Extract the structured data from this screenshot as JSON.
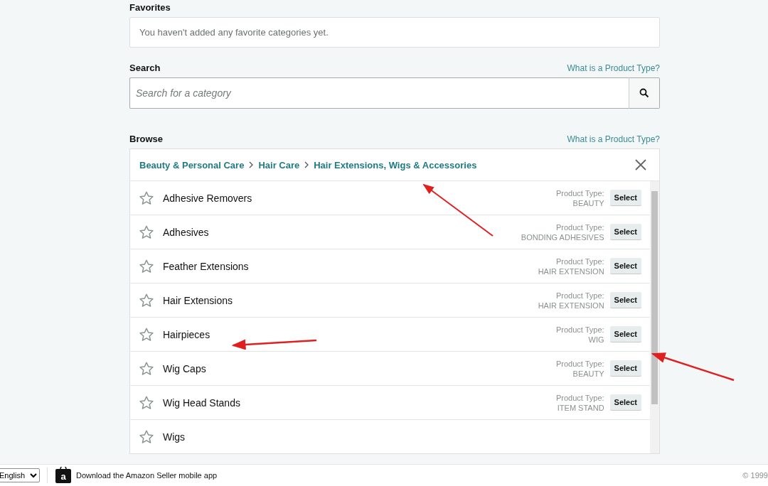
{
  "favorites": {
    "heading": "Favorites",
    "empty_message": "You haven't added any favorite categories yet."
  },
  "search": {
    "heading": "Search",
    "help_link": "What is a Product Type?",
    "placeholder": "Search for a category"
  },
  "browse": {
    "heading": "Browse",
    "help_link": "What is a Product Type?",
    "breadcrumb": [
      "Beauty & Personal Care",
      "Hair Care",
      "Hair Extensions, Wigs & Accessories"
    ],
    "rows": [
      {
        "name": "Adhesive Removers",
        "type_label": "Product Type:",
        "product_type": "BEAUTY",
        "button": "Select",
        "favorite": false
      },
      {
        "name": "Adhesives",
        "type_label": "Product Type:",
        "product_type": "BONDING ADHESIVES",
        "button": "Select",
        "favorite": false
      },
      {
        "name": "Feather Extensions",
        "type_label": "Product Type:",
        "product_type": "HAIR EXTENSION",
        "button": "Select",
        "favorite": false
      },
      {
        "name": "Hair Extensions",
        "type_label": "Product Type:",
        "product_type": "HAIR EXTENSION",
        "button": "Select",
        "favorite": false
      },
      {
        "name": "Hairpieces",
        "type_label": "Product Type:",
        "product_type": "WIG",
        "button": "Select",
        "favorite": false
      },
      {
        "name": "Wig Caps",
        "type_label": "Product Type:",
        "product_type": "BEAUTY",
        "button": "Select",
        "favorite": false
      },
      {
        "name": "Wig Head Stands",
        "type_label": "Product Type:",
        "product_type": "ITEM STAND",
        "button": "Select",
        "favorite": false
      },
      {
        "name": "Wigs",
        "favorite": false
      }
    ]
  },
  "footer": {
    "language": "English",
    "app_icon_letter": "a",
    "app_link": "Download the Amazon Seller mobile app",
    "copyright": "© 1999"
  }
}
